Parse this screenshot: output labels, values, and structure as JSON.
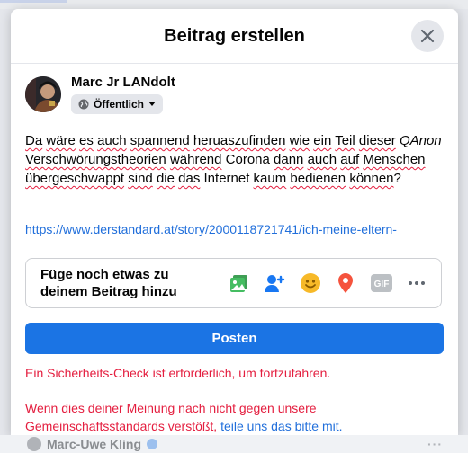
{
  "dialog": {
    "title": "Beitrag erstellen"
  },
  "author": {
    "name": "Marc Jr LANdolt",
    "audience": "Öffentlich"
  },
  "post": {
    "segments": [
      {
        "text": "Da",
        "squiggle": true
      },
      {
        "text": " ",
        "squiggle": false
      },
      {
        "text": "wäre",
        "squiggle": true
      },
      {
        "text": " ",
        "squiggle": false
      },
      {
        "text": "es",
        "squiggle": true
      },
      {
        "text": " ",
        "squiggle": false
      },
      {
        "text": "auch",
        "squiggle": true
      },
      {
        "text": " ",
        "squiggle": false
      },
      {
        "text": "spannend",
        "squiggle": true
      },
      {
        "text": " ",
        "squiggle": false
      },
      {
        "text": "heruaszufinden",
        "squiggle": true
      },
      {
        "text": " ",
        "squiggle": false
      },
      {
        "text": "wie",
        "squiggle": true
      },
      {
        "text": " ",
        "squiggle": false
      },
      {
        "text": "ein",
        "squiggle": true
      },
      {
        "text": " ",
        "squiggle": false
      },
      {
        "text": "Teil",
        "squiggle": true
      },
      {
        "text": " ",
        "squiggle": false
      },
      {
        "text": "dieser",
        "squiggle": true
      },
      {
        "text": " ",
        "squiggle": false
      },
      {
        "text": "QAnon",
        "squiggle": false,
        "italic": true
      },
      {
        "text": " ",
        "squiggle": false
      },
      {
        "text": "Verschwörungstheorien",
        "squiggle": true
      },
      {
        "text": " ",
        "squiggle": false
      },
      {
        "text": "während",
        "squiggle": true
      },
      {
        "text": " Corona ",
        "squiggle": false
      },
      {
        "text": "dann",
        "squiggle": true
      },
      {
        "text": " ",
        "squiggle": false
      },
      {
        "text": "auch",
        "squiggle": true
      },
      {
        "text": " ",
        "squiggle": false
      },
      {
        "text": "auf",
        "squiggle": true
      },
      {
        "text": " ",
        "squiggle": false
      },
      {
        "text": "Menschen",
        "squiggle": true
      },
      {
        "text": " ",
        "squiggle": false
      },
      {
        "text": "übergeschwappt",
        "squiggle": true
      },
      {
        "text": " ",
        "squiggle": false
      },
      {
        "text": "sind",
        "squiggle": true
      },
      {
        "text": " ",
        "squiggle": false
      },
      {
        "text": "die",
        "squiggle": true
      },
      {
        "text": " ",
        "squiggle": false
      },
      {
        "text": "das",
        "squiggle": true
      },
      {
        "text": " Internet ",
        "squiggle": false
      },
      {
        "text": "kaum",
        "squiggle": true
      },
      {
        "text": " ",
        "squiggle": false
      },
      {
        "text": "bedienen",
        "squiggle": true
      },
      {
        "text": " ",
        "squiggle": false
      },
      {
        "text": "können",
        "squiggle": true
      },
      {
        "text": "?",
        "squiggle": false
      }
    ],
    "link": "https://www.derstandard.at/story/2000118721741/ich-meine-eltern-"
  },
  "add_to_post": {
    "label": "Füge noch etwas zu deinem Beitrag hinzu",
    "icons": [
      {
        "name": "photo-video-icon",
        "color": "#45bd62"
      },
      {
        "name": "tag-people-icon",
        "color": "#1877f2"
      },
      {
        "name": "feeling-icon",
        "color": "#f7b928"
      },
      {
        "name": "check-in-icon",
        "color": "#f5533d"
      },
      {
        "name": "gif-icon",
        "color": "#bcc0c4",
        "text": "GIF"
      },
      {
        "name": "more-options-icon",
        "color": "#606770"
      }
    ]
  },
  "post_button": {
    "label": "Posten"
  },
  "security_check": {
    "error": "Ein Sicherheits-Check ist erforderlich, um fortzufahren.",
    "policy_text": "Wenn dies deiner Meinung nach nicht gegen unsere Gemeinschaftsstandards verstößt, ",
    "policy_link": "teile uns das bitte mit."
  },
  "background": {
    "peek_name": "Marc-Uwe Kling",
    "peek_dots": "···"
  }
}
